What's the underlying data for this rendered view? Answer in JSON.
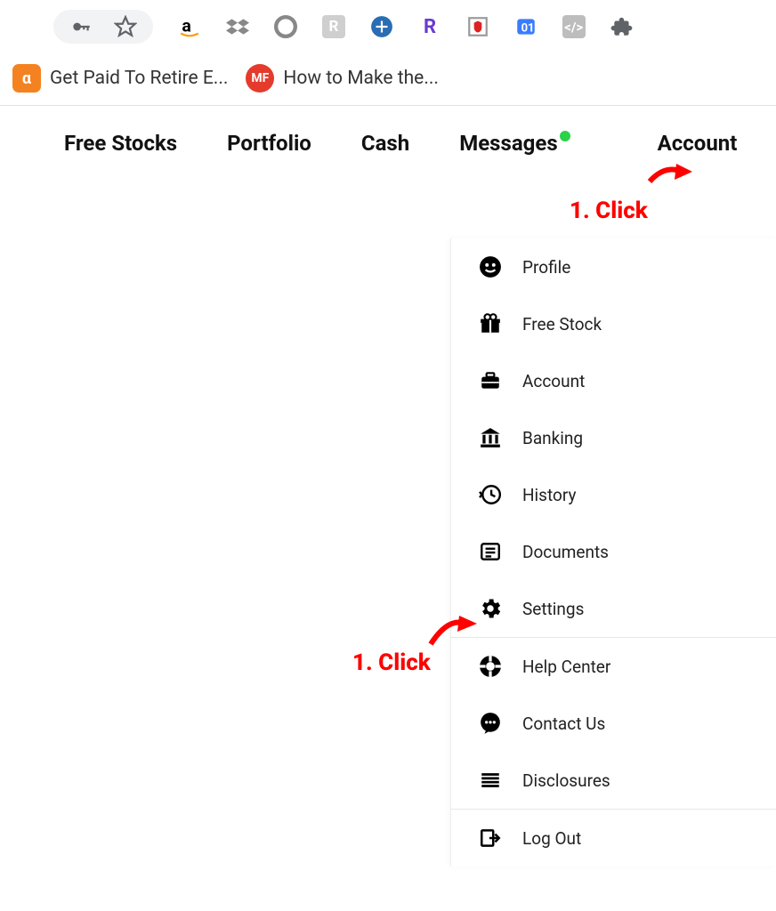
{
  "bookmarks": [
    {
      "label": "Get Paid To Retire E..."
    },
    {
      "label": "How to Make the..."
    }
  ],
  "nav": {
    "free_stocks": "Free Stocks",
    "portfolio": "Portfolio",
    "cash": "Cash",
    "messages": "Messages",
    "account": "Account"
  },
  "menu": {
    "profile": "Profile",
    "free_stock": "Free Stock",
    "account": "Account",
    "banking": "Banking",
    "history": "History",
    "documents": "Documents",
    "settings": "Settings",
    "help_center": "Help Center",
    "contact_us": "Contact Us",
    "disclosures": "Disclosures",
    "log_out": "Log Out"
  },
  "annotations": {
    "click1": "1. Click",
    "click2": "1. Click"
  }
}
